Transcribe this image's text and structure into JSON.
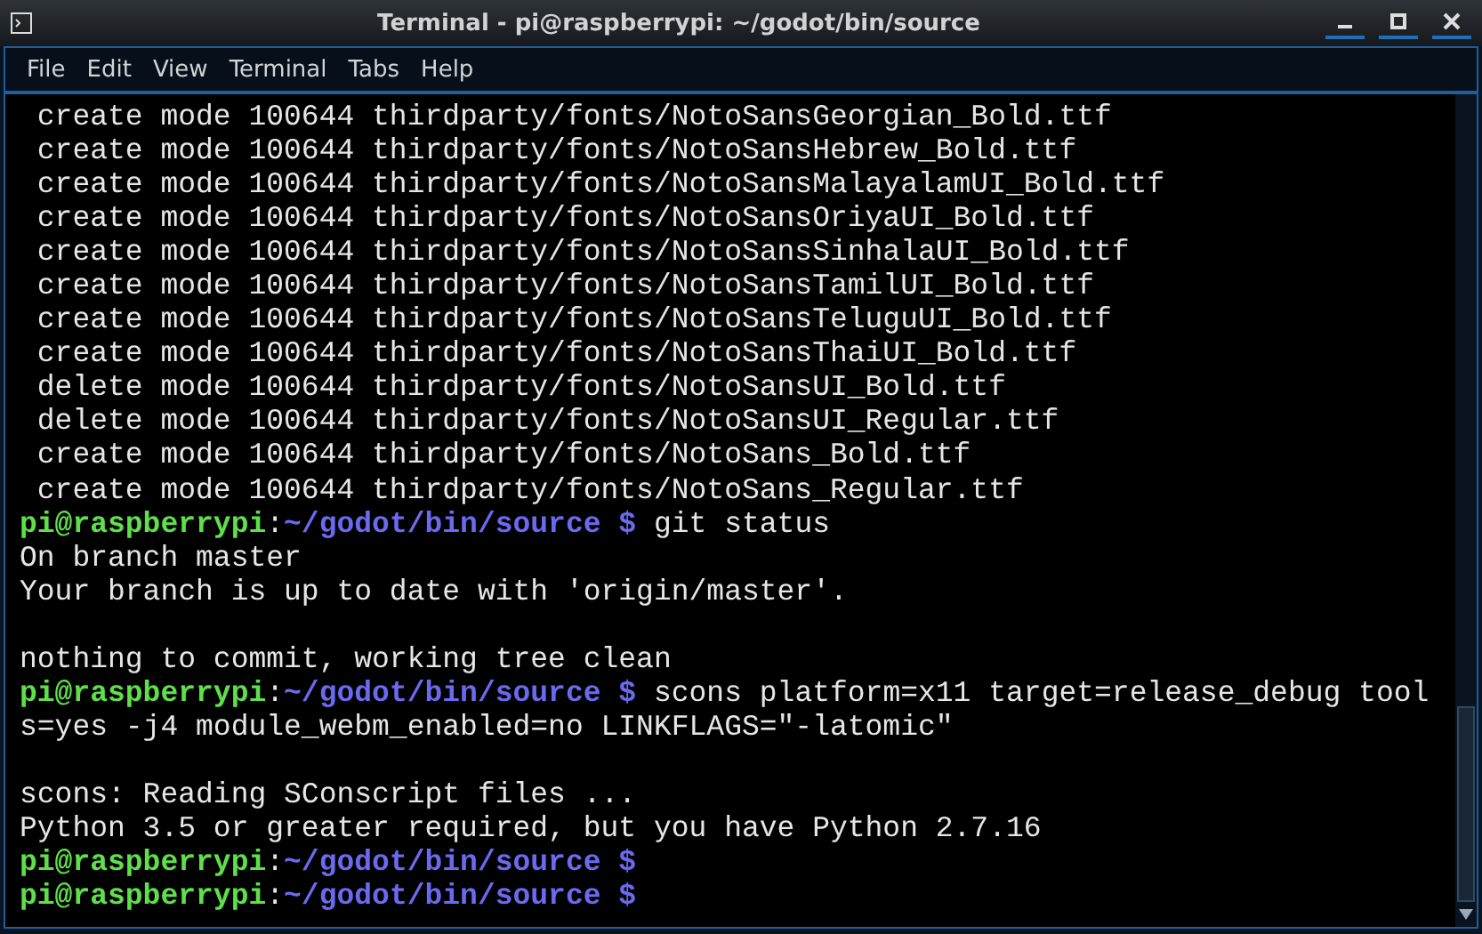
{
  "window": {
    "title": "Terminal - pi@raspberrypi: ~/godot/bin/source"
  },
  "menu": [
    {
      "label": "File"
    },
    {
      "label": "Edit"
    },
    {
      "label": "View"
    },
    {
      "label": "Terminal"
    },
    {
      "label": "Tabs"
    },
    {
      "label": "Help"
    }
  ],
  "terminal": {
    "lines": [
      {
        "kind": "output",
        "text": " create mode 100644 thirdparty/fonts/NotoSansGeorgian_Bold.ttf"
      },
      {
        "kind": "output",
        "text": " create mode 100644 thirdparty/fonts/NotoSansHebrew_Bold.ttf"
      },
      {
        "kind": "output",
        "text": " create mode 100644 thirdparty/fonts/NotoSansMalayalamUI_Bold.ttf"
      },
      {
        "kind": "output",
        "text": " create mode 100644 thirdparty/fonts/NotoSansOriyaUI_Bold.ttf"
      },
      {
        "kind": "output",
        "text": " create mode 100644 thirdparty/fonts/NotoSansSinhalaUI_Bold.ttf"
      },
      {
        "kind": "output",
        "text": " create mode 100644 thirdparty/fonts/NotoSansTamilUI_Bold.ttf"
      },
      {
        "kind": "output",
        "text": " create mode 100644 thirdparty/fonts/NotoSansTeluguUI_Bold.ttf"
      },
      {
        "kind": "output",
        "text": " create mode 100644 thirdparty/fonts/NotoSansThaiUI_Bold.ttf"
      },
      {
        "kind": "output",
        "text": " delete mode 100644 thirdparty/fonts/NotoSansUI_Bold.ttf"
      },
      {
        "kind": "output",
        "text": " delete mode 100644 thirdparty/fonts/NotoSansUI_Regular.ttf"
      },
      {
        "kind": "output",
        "text": " create mode 100644 thirdparty/fonts/NotoSans_Bold.ttf"
      },
      {
        "kind": "output",
        "text": " create mode 100644 thirdparty/fonts/NotoSans_Regular.ttf"
      },
      {
        "kind": "prompt",
        "user": "pi@raspberrypi",
        "sep": ":",
        "path": "~/godot/bin/source",
        "symbol": "$",
        "command": "git status"
      },
      {
        "kind": "output",
        "text": "On branch master"
      },
      {
        "kind": "output",
        "text": "Your branch is up to date with 'origin/master'."
      },
      {
        "kind": "blank"
      },
      {
        "kind": "output",
        "text": "nothing to commit, working tree clean"
      },
      {
        "kind": "prompt",
        "user": "pi@raspberrypi",
        "sep": ":",
        "path": "~/godot/bin/source",
        "symbol": "$",
        "command": "scons platform=x11 target=release_debug tool"
      },
      {
        "kind": "output",
        "text": "s=yes -j4 module_webm_enabled=no LINKFLAGS=\"-latomic\""
      },
      {
        "kind": "blank"
      },
      {
        "kind": "output",
        "text": "scons: Reading SConscript files ..."
      },
      {
        "kind": "output",
        "text": "Python 3.5 or greater required, but you have Python 2.7.16"
      },
      {
        "kind": "prompt",
        "user": "pi@raspberrypi",
        "sep": ":",
        "path": "~/godot/bin/source",
        "symbol": "$"
      },
      {
        "kind": "prompt",
        "user": "pi@raspberrypi",
        "sep": ":",
        "path": "~/godot/bin/source",
        "symbol": "$"
      }
    ]
  }
}
